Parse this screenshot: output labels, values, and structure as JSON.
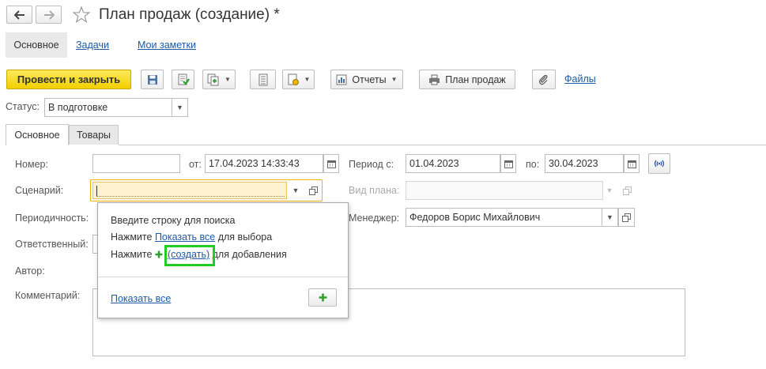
{
  "window": {
    "title": "План продаж (создание) *"
  },
  "nav_tabs": {
    "main": "Основное",
    "tasks": "Задачи",
    "notes": "Мои заметки"
  },
  "toolbar": {
    "post_and_close": "Провести и закрыть",
    "reports": "Отчеты",
    "sales_plan": "План продаж",
    "files": "Файлы"
  },
  "status": {
    "label": "Статус:",
    "value": "В подготовке"
  },
  "content_tabs": {
    "main": "Основное",
    "goods": "Товары"
  },
  "form": {
    "number_label": "Номер:",
    "number_value": "",
    "from_label": "от:",
    "from_value": "17.04.2023 14:33:43",
    "period_label": "Период с:",
    "period_from": "01.04.2023",
    "to_label": "по:",
    "period_to": "30.04.2023",
    "scenario_label": "Сценарий:",
    "scenario_value": "",
    "plan_type_label": "Вид плана:",
    "plan_type_value": "",
    "periodicity_label": "Периодичность:",
    "manager_label": "Менеджер:",
    "manager_value": "Федоров Борис Михайлович",
    "responsible_label": "Ответственный:",
    "author_label": "Автор:",
    "comment_label": "Комментарий:"
  },
  "popup": {
    "line1": "Введите строку для поиска",
    "line2_prefix": "Нажмите ",
    "line2_link": "Показать все",
    "line2_suffix": " для выбора",
    "line3_prefix": "Нажмите ",
    "line3_link": "(создать)",
    "line3_suffix": " для добавления",
    "show_all": "Показать все"
  },
  "colors": {
    "accent_yellow": "#f5d31a",
    "link_blue": "#1c5aa6",
    "highlight_green": "#22cc22",
    "focus_orange": "#f0b400",
    "plus_green": "#2e9e2e"
  }
}
